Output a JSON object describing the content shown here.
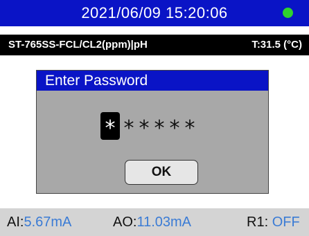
{
  "header": {
    "datetime": "2021/06/09 15:20:06",
    "status_icon": "status-indicator-dot",
    "status_color": "#2fd22f",
    "bar_color": "#0a14c6"
  },
  "info": {
    "model": "ST-765SS-FCL/CL2(ppm)|pH",
    "temperature": "T:31.5  (°C)"
  },
  "dialog": {
    "title": "Enter Password",
    "password_chars": [
      "*",
      "*",
      "*",
      "*",
      "*",
      "*"
    ],
    "ok_label": "OK"
  },
  "status": {
    "ai_label": "AI:",
    "ai_value": "5.67mA",
    "ao_label": "AO:",
    "ao_value": "11.03mA",
    "r1_label": "R1: ",
    "r1_value": "OFF",
    "value_color": "#3a7bd5"
  }
}
